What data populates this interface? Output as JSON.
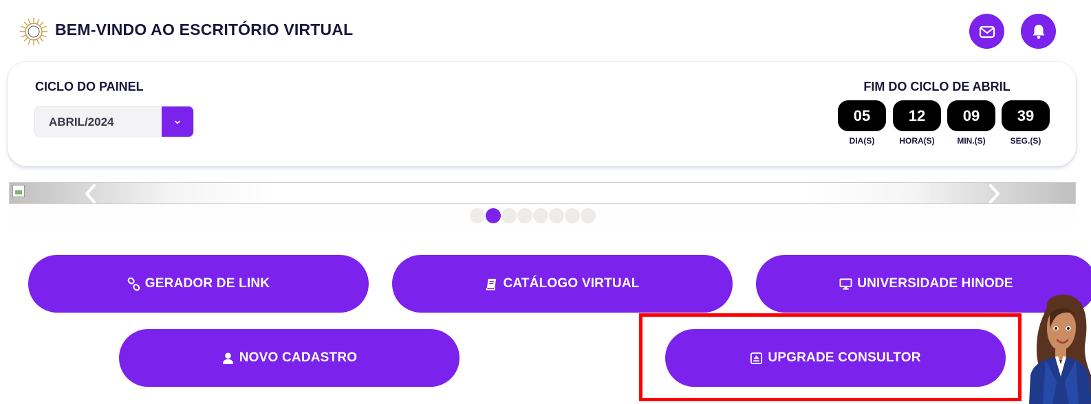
{
  "header": {
    "title": "BEM-VINDO AO ESCRITÓRIO VIRTUAL",
    "logo_icon": "sun-logo-icon",
    "messages_icon": "envelope-icon",
    "notifications_icon": "bell-icon"
  },
  "cycle": {
    "label": "CICLO DO PAINEL",
    "selected": "ABRIL/2024",
    "dropdown_icon": "chevron-down-icon"
  },
  "countdown": {
    "title": "FIM DO CICLO DE ABRIL",
    "units": [
      {
        "value": "05",
        "label": "DIA(S)"
      },
      {
        "value": "12",
        "label": "HORA(S)"
      },
      {
        "value": "09",
        "label": "MIN.(S)"
      },
      {
        "value": "39",
        "label": "SEG.(S)"
      }
    ]
  },
  "carousel": {
    "slide_count": 8,
    "active_index": 1,
    "prev_icon": "chevron-left-icon",
    "next_icon": "chevron-right-icon"
  },
  "actions": {
    "link_generator": "GERADOR DE LINK",
    "virtual_catalog": "CATÁLOGO VIRTUAL",
    "university": "UNIVERSIDADE HINODE",
    "new_registration": "NOVO CADASTRO",
    "upgrade": "UPGRADE CONSULTOR"
  },
  "colors": {
    "primary": "#7b22ec",
    "countdown_bg": "#000000",
    "highlight": "#ff0000",
    "title": "#17163b"
  }
}
